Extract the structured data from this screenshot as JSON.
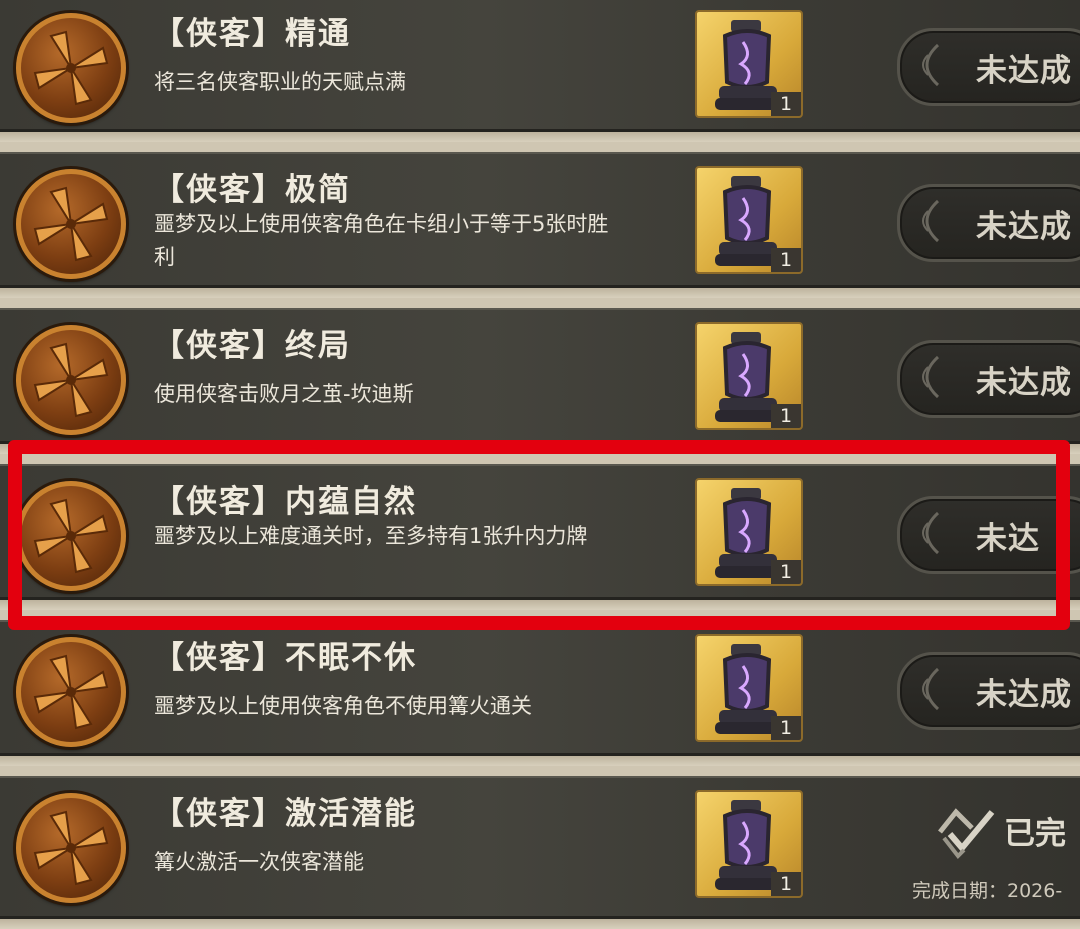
{
  "achievements": [
    {
      "title": "【侠客】精通",
      "description": "将三名侠客职业的天赋点满",
      "reward_qty": "1",
      "status": "未达成"
    },
    {
      "title": "【侠客】极简",
      "description": "噩梦及以上使用侠客角色在卡组小于等于5张时胜利",
      "reward_qty": "1",
      "status": "未达成"
    },
    {
      "title": "【侠客】终局",
      "description": "使用侠客击败月之茧-坎迪斯",
      "reward_qty": "1",
      "status": "未达成"
    },
    {
      "title": "【侠客】内蕴自然",
      "description": "噩梦及以上难度通关时，至多持有1张升内力牌",
      "reward_qty": "1",
      "status": "未达"
    },
    {
      "title": "【侠客】不眠不休",
      "description": "噩梦及以上使用侠客角色不使用篝火通关",
      "reward_qty": "1",
      "status": "未达成"
    },
    {
      "title": "【侠客】激活潜能",
      "description": "篝火激活一次侠客潜能",
      "reward_qty": "1",
      "status": "已完",
      "completion_date": "完成日期：2026-"
    }
  ],
  "colors": {
    "highlight": "#e3000e",
    "medal": "#c9822f",
    "reward_bg": "#f5d36b"
  }
}
